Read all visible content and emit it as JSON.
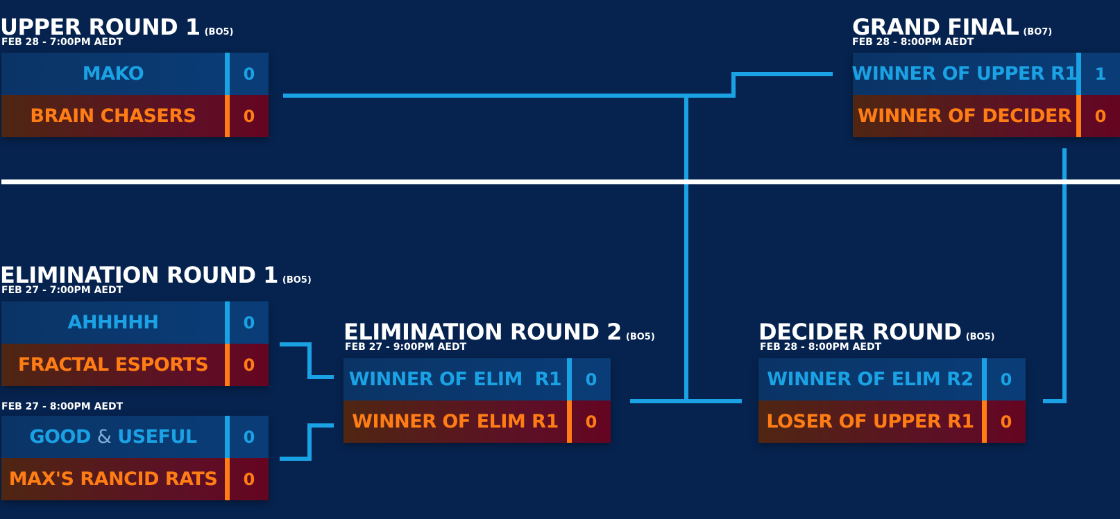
{
  "upper_round_1": {
    "title": "UPPER ROUND 1",
    "format": "(BO5)",
    "date": "FEB 28 - 7:00PM AEDT",
    "team1": {
      "name": "MAKO",
      "score": "0"
    },
    "team2": {
      "name": "BRAIN CHASERS",
      "score": "0"
    }
  },
  "grand_final": {
    "title": "GRAND FINAL",
    "format": "(BO7)",
    "date": "FEB 28 - 8:00PM AEDT",
    "team1": {
      "name": "WINNER OF UPPER R1",
      "score": "1"
    },
    "team2": {
      "name": "WINNER OF DECIDER",
      "score": "0"
    }
  },
  "elimination_round_1": {
    "title": "ELIMINATION ROUND 1",
    "format": "(BO5)",
    "date": "FEB 27 - 7:00PM AEDT",
    "team1": {
      "name": "AHHHHH",
      "score": "0"
    },
    "team2": {
      "name": "FRACTAL ESPORTS",
      "score": "0"
    },
    "second_match": {
      "date": "FEB 27 - 8:00PM AEDT",
      "team1": {
        "name_part1": "GOOD",
        "amp": "&",
        "name_part2": "USEFUL",
        "score": "0"
      },
      "team2": {
        "name": "MAX'S RANCID RATS",
        "score": "0"
      }
    }
  },
  "elimination_round_2": {
    "title": "ELIMINATION ROUND 2",
    "format": "(BO5)",
    "date": "FEB 27 - 9:00PM AEDT",
    "team1": {
      "name": "WINNER OF ELIM  R1",
      "score": "0"
    },
    "team2": {
      "name": "WINNER OF ELIM R1",
      "score": "0"
    }
  },
  "decider_round": {
    "title": "DECIDER ROUND",
    "format": "(BO5)",
    "date": "FEB 28 - 8:00PM AEDT",
    "team1": {
      "name": "WINNER OF ELIM R2",
      "score": "0"
    },
    "team2": {
      "name": "LOSER OF UPPER R1",
      "score": "0"
    }
  },
  "colors": {
    "background": "#06234f",
    "upper_team_text": "#1aa2e4",
    "lower_team_text": "#ff7d14",
    "connector": "#1aa2e4",
    "divider": "#ffffff"
  }
}
